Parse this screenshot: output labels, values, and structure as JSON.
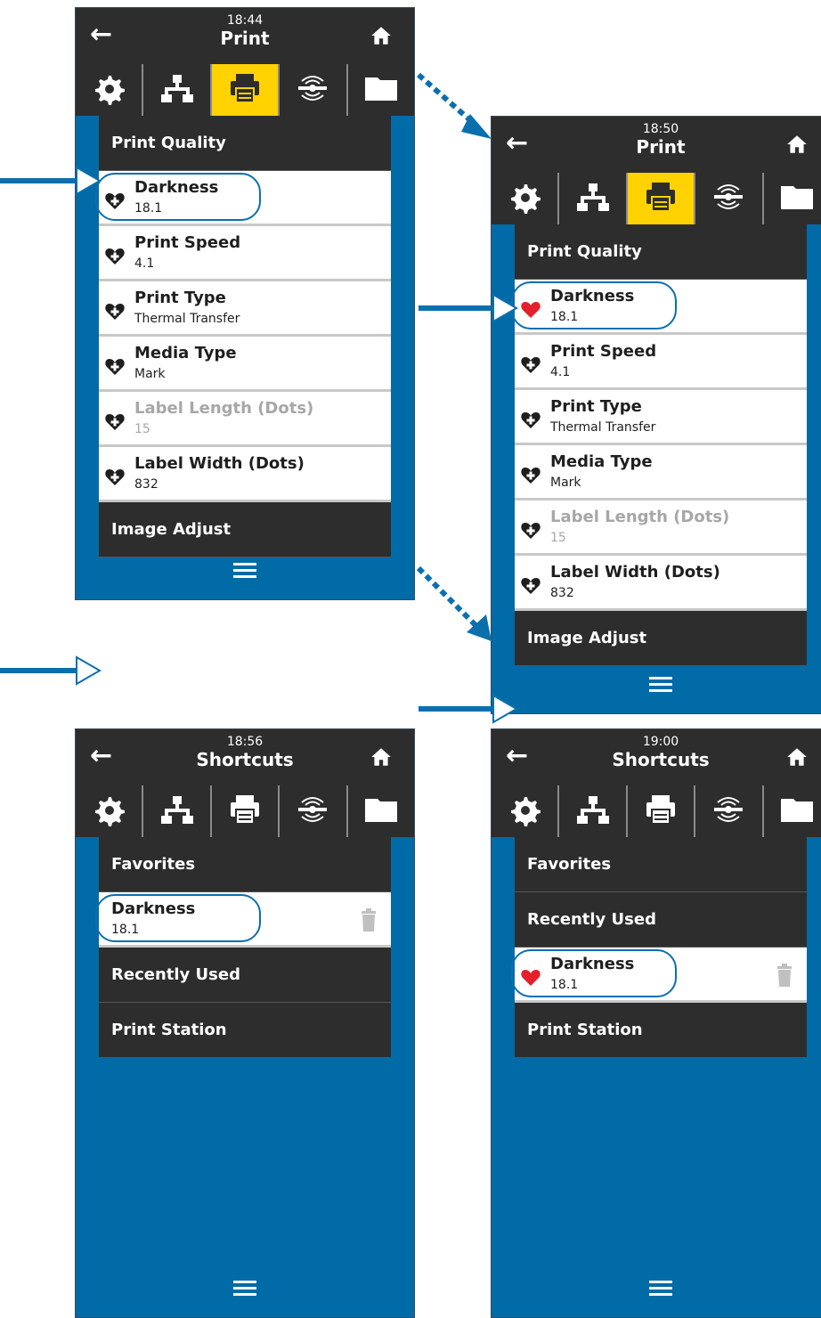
{
  "screens": [
    {
      "time": "18:44",
      "title": "Print",
      "back_icon": "back-arrow-icon",
      "home_icon": "home-icon",
      "tabs": [
        "settings",
        "network",
        "print",
        "rfid",
        "storage"
      ],
      "active_tab": "print",
      "sections": [
        {
          "kind": "header",
          "label": "Print Quality"
        },
        {
          "kind": "item",
          "label": "Darkness",
          "value": "18.1",
          "favorite": false,
          "highlighted": true
        },
        {
          "kind": "item",
          "label": "Print Speed",
          "value": "4.1",
          "favorite": false
        },
        {
          "kind": "item",
          "label": "Print Type",
          "value": "Thermal Transfer",
          "favorite": false
        },
        {
          "kind": "item",
          "label": "Media Type",
          "value": "Mark",
          "favorite": false
        },
        {
          "kind": "item",
          "label": "Label Length (Dots)",
          "value": "15",
          "favorite": false,
          "disabled": true
        },
        {
          "kind": "item",
          "label": "Label Width (Dots)",
          "value": "832",
          "favorite": false
        },
        {
          "kind": "header",
          "label": "Image Adjust"
        }
      ]
    },
    {
      "time": "18:50",
      "title": "Print",
      "tabs": [
        "settings",
        "network",
        "print",
        "rfid",
        "storage"
      ],
      "active_tab": "print",
      "sections": [
        {
          "kind": "header",
          "label": "Print Quality"
        },
        {
          "kind": "item",
          "label": "Darkness",
          "value": "18.1",
          "favorite": true,
          "highlighted": true
        },
        {
          "kind": "item",
          "label": "Print Speed",
          "value": "4.1",
          "favorite": false
        },
        {
          "kind": "item",
          "label": "Print Type",
          "value": "Thermal Transfer",
          "favorite": false
        },
        {
          "kind": "item",
          "label": "Media Type",
          "value": "Mark",
          "favorite": false
        },
        {
          "kind": "item",
          "label": "Label Length (Dots)",
          "value": "15",
          "favorite": false,
          "disabled": true
        },
        {
          "kind": "item",
          "label": "Label Width (Dots)",
          "value": "832",
          "favorite": false
        },
        {
          "kind": "header",
          "label": "Image Adjust"
        }
      ]
    },
    {
      "time": "18:56",
      "title": "Shortcuts",
      "tabs": [
        "settings",
        "network",
        "print",
        "rfid",
        "storage"
      ],
      "active_tab": "",
      "sections": [
        {
          "kind": "header",
          "label": "Favorites"
        },
        {
          "kind": "item",
          "label": "Darkness",
          "value": "18.1",
          "favorite": false,
          "highlighted": true,
          "trash": true,
          "no_heart": true
        },
        {
          "kind": "header",
          "label": "Recently Used"
        },
        {
          "kind": "header",
          "label": "Print Station"
        }
      ]
    },
    {
      "time": "19:00",
      "title": "Shortcuts",
      "tabs": [
        "settings",
        "network",
        "print",
        "rfid",
        "storage"
      ],
      "active_tab": "",
      "sections": [
        {
          "kind": "header",
          "label": "Favorites"
        },
        {
          "kind": "header",
          "label": "Recently Used"
        },
        {
          "kind": "item",
          "label": "Darkness",
          "value": "18.1",
          "favorite": true,
          "highlighted": true,
          "trash": true
        },
        {
          "kind": "header",
          "label": "Print Station"
        }
      ]
    }
  ],
  "colors": {
    "screen_bg": "#006ba6",
    "bar_bg": "#2d2d2d",
    "active_tab": "#ffd200",
    "favorite_heart": "#e3202c",
    "callout": "#0b6fae"
  },
  "menu_icon": "hamburger-menu-icon"
}
